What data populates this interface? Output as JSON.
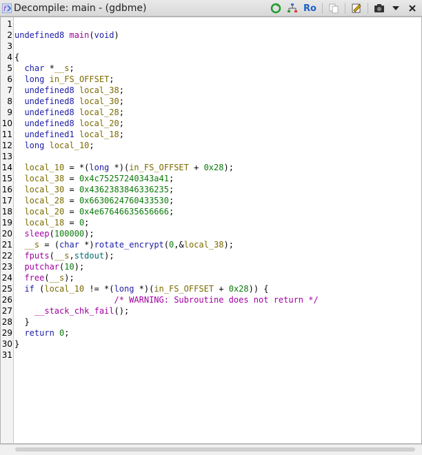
{
  "window": {
    "title": "Decompile: main - (gdbme)",
    "toolbar": {
      "ro_label": "Ro",
      "icons": [
        "refresh-icon",
        "graph-icon",
        "ro-toggle",
        "copy-icon",
        "edit-icon",
        "snapshot-icon",
        "menu-dropdown-icon",
        "close-icon"
      ]
    }
  },
  "code": {
    "lines": [
      {
        "n": "1",
        "segs": []
      },
      {
        "n": "2",
        "segs": [
          {
            "t": "undefined8 ",
            "c": "kw"
          },
          {
            "t": "main",
            "c": "fnc"
          },
          {
            "t": "(",
            "c": ""
          },
          {
            "t": "void",
            "c": "kw"
          },
          {
            "t": ")",
            "c": ""
          }
        ]
      },
      {
        "n": "3",
        "segs": []
      },
      {
        "n": "4",
        "segs": [
          {
            "t": "{",
            "c": ""
          }
        ]
      },
      {
        "n": "5",
        "segs": [
          {
            "t": "  ",
            "c": ""
          },
          {
            "t": "char",
            "c": "kw"
          },
          {
            "t": " *",
            "c": ""
          },
          {
            "t": "__s",
            "c": "var"
          },
          {
            "t": ";",
            "c": ""
          }
        ]
      },
      {
        "n": "6",
        "segs": [
          {
            "t": "  ",
            "c": ""
          },
          {
            "t": "long",
            "c": "kw"
          },
          {
            "t": " ",
            "c": ""
          },
          {
            "t": "in_FS_OFFSET",
            "c": "var"
          },
          {
            "t": ";",
            "c": ""
          }
        ]
      },
      {
        "n": "7",
        "segs": [
          {
            "t": "  ",
            "c": ""
          },
          {
            "t": "undefined8",
            "c": "kw"
          },
          {
            "t": " ",
            "c": ""
          },
          {
            "t": "local_38",
            "c": "var"
          },
          {
            "t": ";",
            "c": ""
          }
        ]
      },
      {
        "n": "8",
        "segs": [
          {
            "t": "  ",
            "c": ""
          },
          {
            "t": "undefined8",
            "c": "kw"
          },
          {
            "t": " ",
            "c": ""
          },
          {
            "t": "local_30",
            "c": "var"
          },
          {
            "t": ";",
            "c": ""
          }
        ]
      },
      {
        "n": "9",
        "segs": [
          {
            "t": "  ",
            "c": ""
          },
          {
            "t": "undefined8",
            "c": "kw"
          },
          {
            "t": " ",
            "c": ""
          },
          {
            "t": "local_28",
            "c": "var"
          },
          {
            "t": ";",
            "c": ""
          }
        ]
      },
      {
        "n": "10",
        "segs": [
          {
            "t": "  ",
            "c": ""
          },
          {
            "t": "undefined8",
            "c": "kw"
          },
          {
            "t": " ",
            "c": ""
          },
          {
            "t": "local_20",
            "c": "var"
          },
          {
            "t": ";",
            "c": ""
          }
        ]
      },
      {
        "n": "11",
        "segs": [
          {
            "t": "  ",
            "c": ""
          },
          {
            "t": "undefined1",
            "c": "kw"
          },
          {
            "t": " ",
            "c": ""
          },
          {
            "t": "local_18",
            "c": "var"
          },
          {
            "t": ";",
            "c": ""
          }
        ]
      },
      {
        "n": "12",
        "segs": [
          {
            "t": "  ",
            "c": ""
          },
          {
            "t": "long",
            "c": "kw"
          },
          {
            "t": " ",
            "c": ""
          },
          {
            "t": "local_10",
            "c": "var"
          },
          {
            "t": ";",
            "c": ""
          }
        ]
      },
      {
        "n": "13",
        "segs": []
      },
      {
        "n": "14",
        "segs": [
          {
            "t": "  ",
            "c": ""
          },
          {
            "t": "local_10",
            "c": "var"
          },
          {
            "t": " = *(",
            "c": ""
          },
          {
            "t": "long",
            "c": "kw"
          },
          {
            "t": " *)(",
            "c": ""
          },
          {
            "t": "in_FS_OFFSET",
            "c": "var"
          },
          {
            "t": " + ",
            "c": ""
          },
          {
            "t": "0x28",
            "c": "num"
          },
          {
            "t": ");",
            "c": ""
          }
        ]
      },
      {
        "n": "15",
        "segs": [
          {
            "t": "  ",
            "c": ""
          },
          {
            "t": "local_38",
            "c": "var"
          },
          {
            "t": " = ",
            "c": ""
          },
          {
            "t": "0x4c75257240343a41",
            "c": "num"
          },
          {
            "t": ";",
            "c": ""
          }
        ]
      },
      {
        "n": "16",
        "segs": [
          {
            "t": "  ",
            "c": ""
          },
          {
            "t": "local_30",
            "c": "var"
          },
          {
            "t": " = ",
            "c": ""
          },
          {
            "t": "0x4362383846336235",
            "c": "num"
          },
          {
            "t": ";",
            "c": ""
          }
        ]
      },
      {
        "n": "17",
        "segs": [
          {
            "t": "  ",
            "c": ""
          },
          {
            "t": "local_28",
            "c": "var"
          },
          {
            "t": " = ",
            "c": ""
          },
          {
            "t": "0x6630624760433530",
            "c": "num"
          },
          {
            "t": ";",
            "c": ""
          }
        ]
      },
      {
        "n": "18",
        "segs": [
          {
            "t": "  ",
            "c": ""
          },
          {
            "t": "local_20",
            "c": "var"
          },
          {
            "t": " = ",
            "c": ""
          },
          {
            "t": "0x4e67646635656666",
            "c": "num"
          },
          {
            "t": ";",
            "c": ""
          }
        ]
      },
      {
        "n": "19",
        "segs": [
          {
            "t": "  ",
            "c": ""
          },
          {
            "t": "local_18",
            "c": "var"
          },
          {
            "t": " = ",
            "c": ""
          },
          {
            "t": "0",
            "c": "num"
          },
          {
            "t": ";",
            "c": ""
          }
        ]
      },
      {
        "n": "20",
        "segs": [
          {
            "t": "  ",
            "c": ""
          },
          {
            "t": "sleep",
            "c": "fnc"
          },
          {
            "t": "(",
            "c": ""
          },
          {
            "t": "100000",
            "c": "num"
          },
          {
            "t": ");",
            "c": ""
          }
        ]
      },
      {
        "n": "21",
        "segs": [
          {
            "t": "  ",
            "c": ""
          },
          {
            "t": "__s",
            "c": "var"
          },
          {
            "t": " = (",
            "c": ""
          },
          {
            "t": "char",
            "c": "kw"
          },
          {
            "t": " *)",
            "c": ""
          },
          {
            "t": "rotate_encrypt",
            "c": "fn"
          },
          {
            "t": "(",
            "c": ""
          },
          {
            "t": "0",
            "c": "num"
          },
          {
            "t": ",&",
            "c": ""
          },
          {
            "t": "local_38",
            "c": "var"
          },
          {
            "t": ");",
            "c": ""
          }
        ]
      },
      {
        "n": "22",
        "segs": [
          {
            "t": "  ",
            "c": ""
          },
          {
            "t": "fputs",
            "c": "fnc"
          },
          {
            "t": "(",
            "c": ""
          },
          {
            "t": "__s",
            "c": "var"
          },
          {
            "t": ",",
            "c": ""
          },
          {
            "t": "stdout",
            "c": "glob"
          },
          {
            "t": ");",
            "c": ""
          }
        ]
      },
      {
        "n": "23",
        "segs": [
          {
            "t": "  ",
            "c": ""
          },
          {
            "t": "putchar",
            "c": "fnc"
          },
          {
            "t": "(",
            "c": ""
          },
          {
            "t": "10",
            "c": "num"
          },
          {
            "t": ");",
            "c": ""
          }
        ]
      },
      {
        "n": "24",
        "segs": [
          {
            "t": "  ",
            "c": ""
          },
          {
            "t": "free",
            "c": "fnc"
          },
          {
            "t": "(",
            "c": ""
          },
          {
            "t": "__s",
            "c": "var"
          },
          {
            "t": ");",
            "c": ""
          }
        ]
      },
      {
        "n": "25",
        "segs": [
          {
            "t": "  ",
            "c": ""
          },
          {
            "t": "if",
            "c": "kw"
          },
          {
            "t": " (",
            "c": ""
          },
          {
            "t": "local_10",
            "c": "var"
          },
          {
            "t": " != *(",
            "c": ""
          },
          {
            "t": "long",
            "c": "kw"
          },
          {
            "t": " *)(",
            "c": ""
          },
          {
            "t": "in_FS_OFFSET",
            "c": "var"
          },
          {
            "t": " + ",
            "c": ""
          },
          {
            "t": "0x28",
            "c": "num"
          },
          {
            "t": ")) {",
            "c": ""
          }
        ]
      },
      {
        "n": "26",
        "segs": [
          {
            "t": "                    ",
            "c": ""
          },
          {
            "t": "/* WARNING: Subroutine does not return */",
            "c": "cmt"
          }
        ]
      },
      {
        "n": "27",
        "segs": [
          {
            "t": "    ",
            "c": ""
          },
          {
            "t": "__stack_chk_fail",
            "c": "fnc"
          },
          {
            "t": "();",
            "c": ""
          }
        ]
      },
      {
        "n": "28",
        "segs": [
          {
            "t": "  }",
            "c": ""
          }
        ]
      },
      {
        "n": "29",
        "segs": [
          {
            "t": "  ",
            "c": ""
          },
          {
            "t": "return",
            "c": "kw"
          },
          {
            "t": " ",
            "c": ""
          },
          {
            "t": "0",
            "c": "num"
          },
          {
            "t": ";",
            "c": ""
          }
        ]
      },
      {
        "n": "30",
        "segs": [
          {
            "t": "}",
            "c": ""
          }
        ]
      },
      {
        "n": "31",
        "segs": []
      }
    ]
  }
}
